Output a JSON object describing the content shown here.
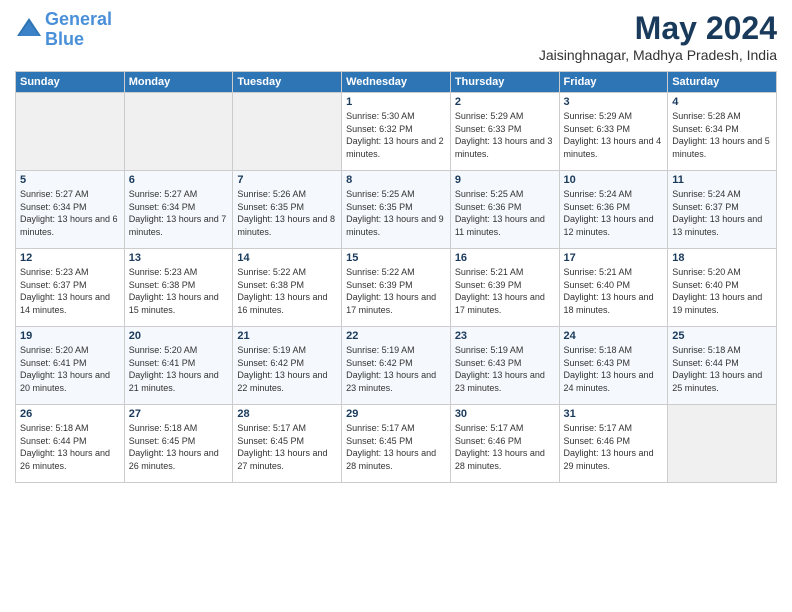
{
  "header": {
    "logo_line1": "General",
    "logo_line2": "Blue",
    "month_year": "May 2024",
    "location": "Jaisinghnagar, Madhya Pradesh, India"
  },
  "weekdays": [
    "Sunday",
    "Monday",
    "Tuesday",
    "Wednesday",
    "Thursday",
    "Friday",
    "Saturday"
  ],
  "weeks": [
    [
      {
        "day": "",
        "sunrise": "",
        "sunset": "",
        "daylight": ""
      },
      {
        "day": "",
        "sunrise": "",
        "sunset": "",
        "daylight": ""
      },
      {
        "day": "",
        "sunrise": "",
        "sunset": "",
        "daylight": ""
      },
      {
        "day": "1",
        "sunrise": "Sunrise: 5:30 AM",
        "sunset": "Sunset: 6:32 PM",
        "daylight": "Daylight: 13 hours and 2 minutes."
      },
      {
        "day": "2",
        "sunrise": "Sunrise: 5:29 AM",
        "sunset": "Sunset: 6:33 PM",
        "daylight": "Daylight: 13 hours and 3 minutes."
      },
      {
        "day": "3",
        "sunrise": "Sunrise: 5:29 AM",
        "sunset": "Sunset: 6:33 PM",
        "daylight": "Daylight: 13 hours and 4 minutes."
      },
      {
        "day": "4",
        "sunrise": "Sunrise: 5:28 AM",
        "sunset": "Sunset: 6:34 PM",
        "daylight": "Daylight: 13 hours and 5 minutes."
      }
    ],
    [
      {
        "day": "5",
        "sunrise": "Sunrise: 5:27 AM",
        "sunset": "Sunset: 6:34 PM",
        "daylight": "Daylight: 13 hours and 6 minutes."
      },
      {
        "day": "6",
        "sunrise": "Sunrise: 5:27 AM",
        "sunset": "Sunset: 6:34 PM",
        "daylight": "Daylight: 13 hours and 7 minutes."
      },
      {
        "day": "7",
        "sunrise": "Sunrise: 5:26 AM",
        "sunset": "Sunset: 6:35 PM",
        "daylight": "Daylight: 13 hours and 8 minutes."
      },
      {
        "day": "8",
        "sunrise": "Sunrise: 5:25 AM",
        "sunset": "Sunset: 6:35 PM",
        "daylight": "Daylight: 13 hours and 9 minutes."
      },
      {
        "day": "9",
        "sunrise": "Sunrise: 5:25 AM",
        "sunset": "Sunset: 6:36 PM",
        "daylight": "Daylight: 13 hours and 11 minutes."
      },
      {
        "day": "10",
        "sunrise": "Sunrise: 5:24 AM",
        "sunset": "Sunset: 6:36 PM",
        "daylight": "Daylight: 13 hours and 12 minutes."
      },
      {
        "day": "11",
        "sunrise": "Sunrise: 5:24 AM",
        "sunset": "Sunset: 6:37 PM",
        "daylight": "Daylight: 13 hours and 13 minutes."
      }
    ],
    [
      {
        "day": "12",
        "sunrise": "Sunrise: 5:23 AM",
        "sunset": "Sunset: 6:37 PM",
        "daylight": "Daylight: 13 hours and 14 minutes."
      },
      {
        "day": "13",
        "sunrise": "Sunrise: 5:23 AM",
        "sunset": "Sunset: 6:38 PM",
        "daylight": "Daylight: 13 hours and 15 minutes."
      },
      {
        "day": "14",
        "sunrise": "Sunrise: 5:22 AM",
        "sunset": "Sunset: 6:38 PM",
        "daylight": "Daylight: 13 hours and 16 minutes."
      },
      {
        "day": "15",
        "sunrise": "Sunrise: 5:22 AM",
        "sunset": "Sunset: 6:39 PM",
        "daylight": "Daylight: 13 hours and 17 minutes."
      },
      {
        "day": "16",
        "sunrise": "Sunrise: 5:21 AM",
        "sunset": "Sunset: 6:39 PM",
        "daylight": "Daylight: 13 hours and 17 minutes."
      },
      {
        "day": "17",
        "sunrise": "Sunrise: 5:21 AM",
        "sunset": "Sunset: 6:40 PM",
        "daylight": "Daylight: 13 hours and 18 minutes."
      },
      {
        "day": "18",
        "sunrise": "Sunrise: 5:20 AM",
        "sunset": "Sunset: 6:40 PM",
        "daylight": "Daylight: 13 hours and 19 minutes."
      }
    ],
    [
      {
        "day": "19",
        "sunrise": "Sunrise: 5:20 AM",
        "sunset": "Sunset: 6:41 PM",
        "daylight": "Daylight: 13 hours and 20 minutes."
      },
      {
        "day": "20",
        "sunrise": "Sunrise: 5:20 AM",
        "sunset": "Sunset: 6:41 PM",
        "daylight": "Daylight: 13 hours and 21 minutes."
      },
      {
        "day": "21",
        "sunrise": "Sunrise: 5:19 AM",
        "sunset": "Sunset: 6:42 PM",
        "daylight": "Daylight: 13 hours and 22 minutes."
      },
      {
        "day": "22",
        "sunrise": "Sunrise: 5:19 AM",
        "sunset": "Sunset: 6:42 PM",
        "daylight": "Daylight: 13 hours and 23 minutes."
      },
      {
        "day": "23",
        "sunrise": "Sunrise: 5:19 AM",
        "sunset": "Sunset: 6:43 PM",
        "daylight": "Daylight: 13 hours and 23 minutes."
      },
      {
        "day": "24",
        "sunrise": "Sunrise: 5:18 AM",
        "sunset": "Sunset: 6:43 PM",
        "daylight": "Daylight: 13 hours and 24 minutes."
      },
      {
        "day": "25",
        "sunrise": "Sunrise: 5:18 AM",
        "sunset": "Sunset: 6:44 PM",
        "daylight": "Daylight: 13 hours and 25 minutes."
      }
    ],
    [
      {
        "day": "26",
        "sunrise": "Sunrise: 5:18 AM",
        "sunset": "Sunset: 6:44 PM",
        "daylight": "Daylight: 13 hours and 26 minutes."
      },
      {
        "day": "27",
        "sunrise": "Sunrise: 5:18 AM",
        "sunset": "Sunset: 6:45 PM",
        "daylight": "Daylight: 13 hours and 26 minutes."
      },
      {
        "day": "28",
        "sunrise": "Sunrise: 5:17 AM",
        "sunset": "Sunset: 6:45 PM",
        "daylight": "Daylight: 13 hours and 27 minutes."
      },
      {
        "day": "29",
        "sunrise": "Sunrise: 5:17 AM",
        "sunset": "Sunset: 6:45 PM",
        "daylight": "Daylight: 13 hours and 28 minutes."
      },
      {
        "day": "30",
        "sunrise": "Sunrise: 5:17 AM",
        "sunset": "Sunset: 6:46 PM",
        "daylight": "Daylight: 13 hours and 28 minutes."
      },
      {
        "day": "31",
        "sunrise": "Sunrise: 5:17 AM",
        "sunset": "Sunset: 6:46 PM",
        "daylight": "Daylight: 13 hours and 29 minutes."
      },
      {
        "day": "",
        "sunrise": "",
        "sunset": "",
        "daylight": ""
      }
    ]
  ]
}
